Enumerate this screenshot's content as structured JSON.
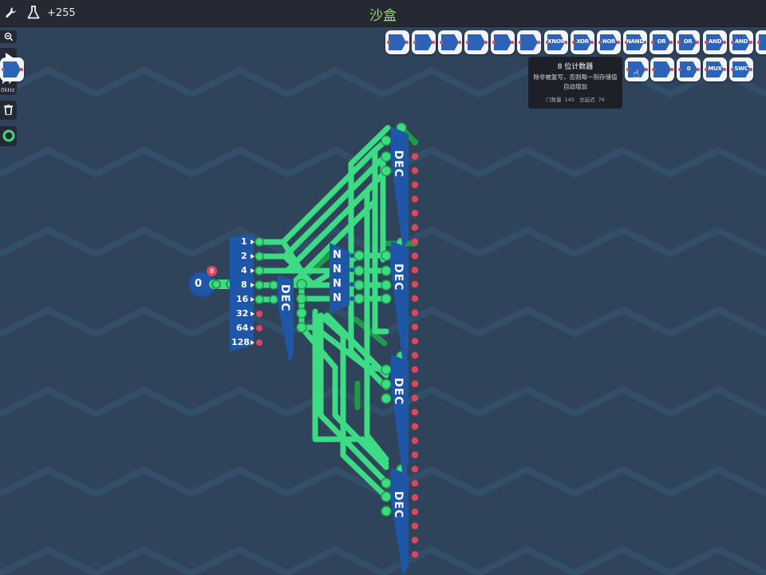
{
  "topbar": {
    "count": "+255",
    "title": "沙盒"
  },
  "sidebar": {
    "speed_label": "0kHz"
  },
  "toolbox_row1": [
    "",
    "",
    "",
    "",
    "",
    "",
    "XNOR",
    "XOR",
    "NOR",
    "NAND",
    "OR",
    "OR",
    "AND",
    "AND",
    ""
  ],
  "toolbox_row2": [
    "",
    "0",
    "MUX",
    "SWC",
    ""
  ],
  "tooltip": {
    "title": "8 位计数器",
    "line1": "除非被复写，否则每一刻存储值",
    "line2": "自动增加",
    "gates_label": "门数量",
    "gates_value": "145",
    "delay_label": "总延迟",
    "delay_value": "76"
  },
  "circuit": {
    "counter_value": "0",
    "counter_badge": "8",
    "inputs": [
      "1",
      "2",
      "4",
      "8",
      "16",
      "32",
      "64",
      "128"
    ],
    "decoder_label": "DEC",
    "not_label": "N"
  },
  "colors": {
    "wire": "#3ddc84",
    "wire_dark": "#1f9a47",
    "component": "#1f57a8",
    "pin": "#e0455e",
    "background": "#2f445b"
  }
}
